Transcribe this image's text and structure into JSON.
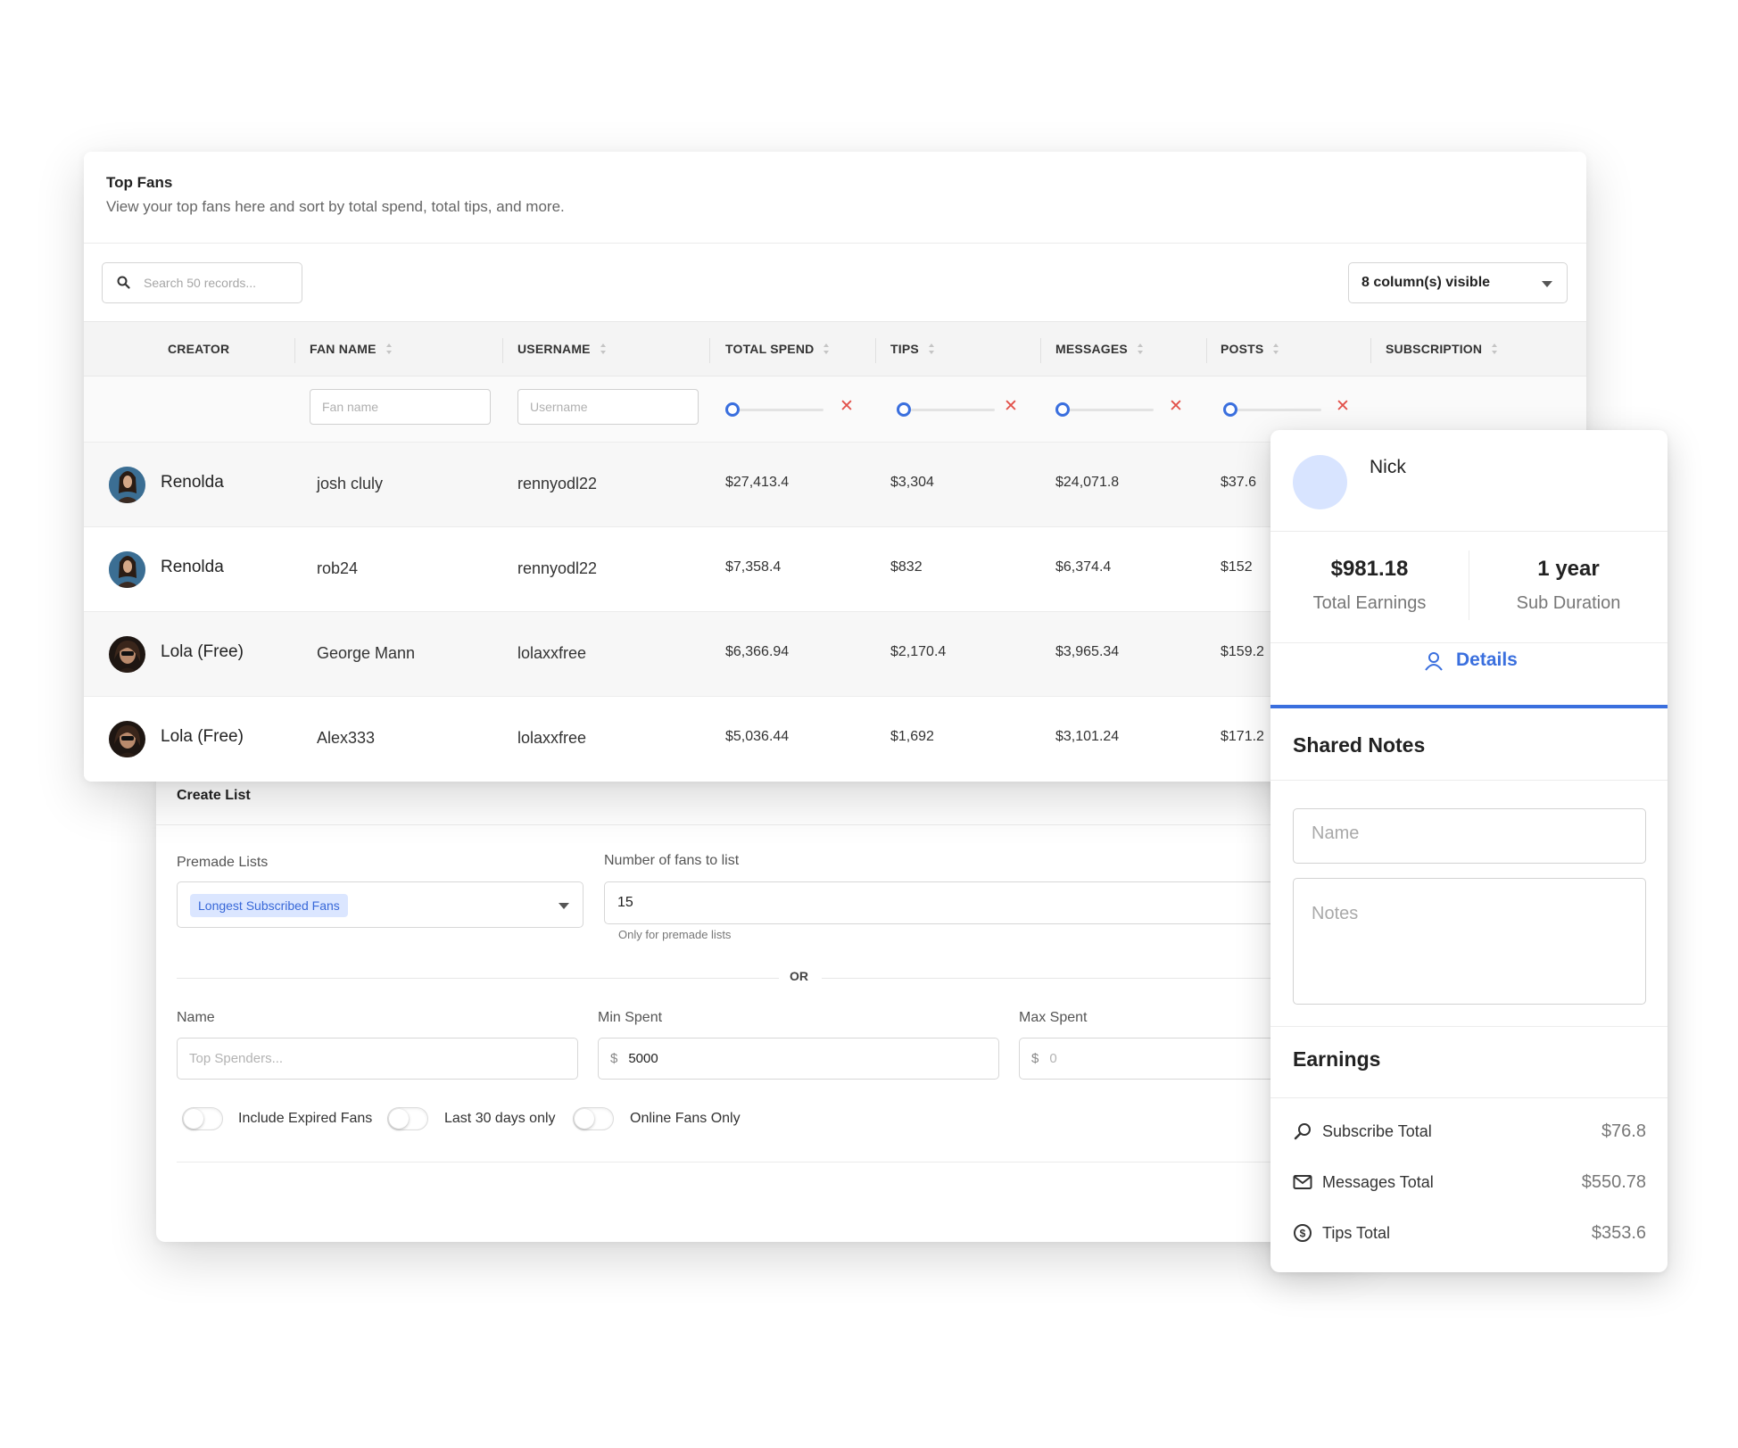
{
  "create_list": {
    "title": "Create List",
    "premade_label": "Premade Lists",
    "premade_selected": "Longest Subscribed Fans",
    "num_fans_label": "Number of fans to list",
    "num_fans_value": "15",
    "num_fans_hint": "Only for premade lists",
    "or_text": "OR",
    "name_label": "Name",
    "name_placeholder": "Top Spenders...",
    "min_spent_label": "Min Spent",
    "min_spent_currency": "$",
    "min_spent_value": "5000",
    "max_spent_label": "Max Spent",
    "max_spent_currency": "$",
    "max_spent_placeholder": "0",
    "toggles": [
      "Include Expired Fans",
      "Last 30 days only",
      "Online Fans Only"
    ]
  },
  "top_fans": {
    "title": "Top Fans",
    "subtitle": "View your top fans here and sort by total spend, total tips, and more.",
    "search_placeholder": "Search 50 records...",
    "columns_visible": "8 column(s) visible",
    "columns": [
      "CREATOR",
      "FAN NAME",
      "USERNAME",
      "TOTAL SPEND",
      "TIPS",
      "MESSAGES",
      "POSTS",
      "SUBSCRIPTION"
    ],
    "filters": {
      "fan_name_placeholder": "Fan name",
      "username_placeholder": "Username"
    },
    "rows": [
      {
        "creator": "Renolda",
        "fan_name": "josh cluly",
        "username": "rennyodl22",
        "total_spend": "$27,413.4",
        "tips": "$3,304",
        "messages": "$24,071.8",
        "posts": "$37.6"
      },
      {
        "creator": "Renolda",
        "fan_name": "rob24",
        "username": "rennyodl22",
        "total_spend": "$7,358.4",
        "tips": "$832",
        "messages": "$6,374.4",
        "posts": "$152"
      },
      {
        "creator": "Lola (Free)",
        "fan_name": "George Mann",
        "username": "lolaxxfree",
        "total_spend": "$6,366.94",
        "tips": "$2,170.4",
        "messages": "$3,965.34",
        "posts": "$159.2"
      },
      {
        "creator": "Lola (Free)",
        "fan_name": "Alex333",
        "username": "lolaxxfree",
        "total_spend": "$5,036.44",
        "tips": "$1,692",
        "messages": "$3,101.24",
        "posts": "$171.2"
      }
    ]
  },
  "fan_detail": {
    "name": "Nick",
    "total_earnings_value": "$981.18",
    "total_earnings_label": "Total Earnings",
    "sub_duration_value": "1 year",
    "sub_duration_label": "Sub Duration",
    "tab_label": "Details",
    "shared_notes_title": "Shared Notes",
    "name_placeholder": "Name",
    "notes_placeholder": "Notes",
    "earnings_title": "Earnings",
    "earnings": [
      {
        "label": "Subscribe Total",
        "value": "$76.8",
        "icon": "search-icon"
      },
      {
        "label": "Messages Total",
        "value": "$550.78",
        "icon": "mail-icon"
      },
      {
        "label": "Tips Total",
        "value": "$353.6",
        "icon": "dollar-circle-icon"
      }
    ]
  },
  "colors": {
    "accent": "#3a6fde",
    "clear": "#e2514a",
    "tag_bg": "#dbe6ff"
  }
}
